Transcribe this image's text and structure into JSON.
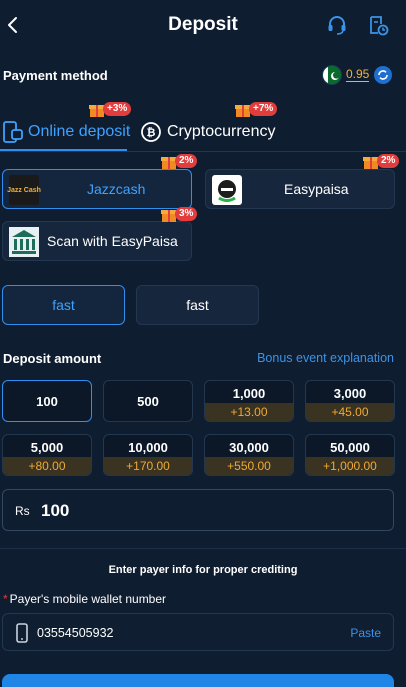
{
  "header": {
    "title": "Deposit"
  },
  "payment_method": {
    "label": "Payment method",
    "balance": "0.95"
  },
  "tabs": [
    {
      "label": "Online deposit",
      "badge": "+3%"
    },
    {
      "label": "Cryptocurrency",
      "badge": "+7%"
    }
  ],
  "channels": [
    {
      "logo_text": "Jazz Cash",
      "label": "Jazzcash",
      "badge": "2%"
    },
    {
      "label": "Easypaisa",
      "badge": "2%"
    },
    {
      "label": "Scan with EasyPaisa",
      "badge": "3%"
    }
  ],
  "speed_options": [
    {
      "label": "fast"
    },
    {
      "label": "fast"
    }
  ],
  "deposit_amount": {
    "label": "Deposit amount",
    "bonus_link": "Bonus event explanation",
    "options": [
      {
        "value": "100",
        "bonus": ""
      },
      {
        "value": "500",
        "bonus": ""
      },
      {
        "value": "1,000",
        "bonus": "+13.00"
      },
      {
        "value": "3,000",
        "bonus": "+45.00"
      },
      {
        "value": "5,000",
        "bonus": "+80.00"
      },
      {
        "value": "10,000",
        "bonus": "+170.00"
      },
      {
        "value": "30,000",
        "bonus": "+550.00"
      },
      {
        "value": "50,000",
        "bonus": "+1,000.00"
      }
    ],
    "currency": "Rs",
    "input_value": "100"
  },
  "payer": {
    "hint": "Enter payer info for proper crediting",
    "required_mark": "*",
    "field_label": "Payer's mobile wallet number",
    "phone_value": "03554505932",
    "paste_label": "Paste"
  },
  "colors": {
    "background": "#0f1d30",
    "accent": "#2f8ef0",
    "bonus": "#f0a933",
    "badge": "#e23c3c"
  }
}
